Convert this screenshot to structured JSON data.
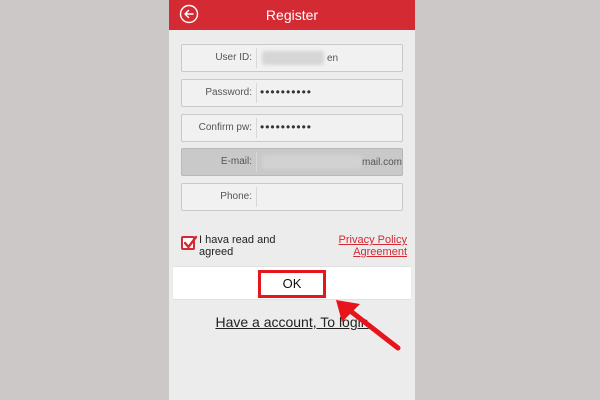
{
  "header": {
    "title": "Register",
    "back_icon": "back-arrow-icon"
  },
  "form": {
    "user_id": {
      "label": "User ID:",
      "value_suffix": "en"
    },
    "password": {
      "label": "Password:",
      "value": "••••••••••"
    },
    "confirm_pw": {
      "label": "Confirm pw:",
      "value": "••••••••••"
    },
    "email": {
      "label": "E-mail:",
      "value_suffix": "mail.com"
    },
    "phone": {
      "label": "Phone:",
      "value": ""
    }
  },
  "agreement": {
    "checked": true,
    "text": "I hava read and agreed",
    "link": "Privacy Policy Agreement"
  },
  "actions": {
    "ok_label": "OK",
    "login_link": "Have a account, To login"
  },
  "colors": {
    "brand_red": "#d42a33",
    "highlight_red": "#e8141c",
    "background": "#cdc8c8"
  }
}
